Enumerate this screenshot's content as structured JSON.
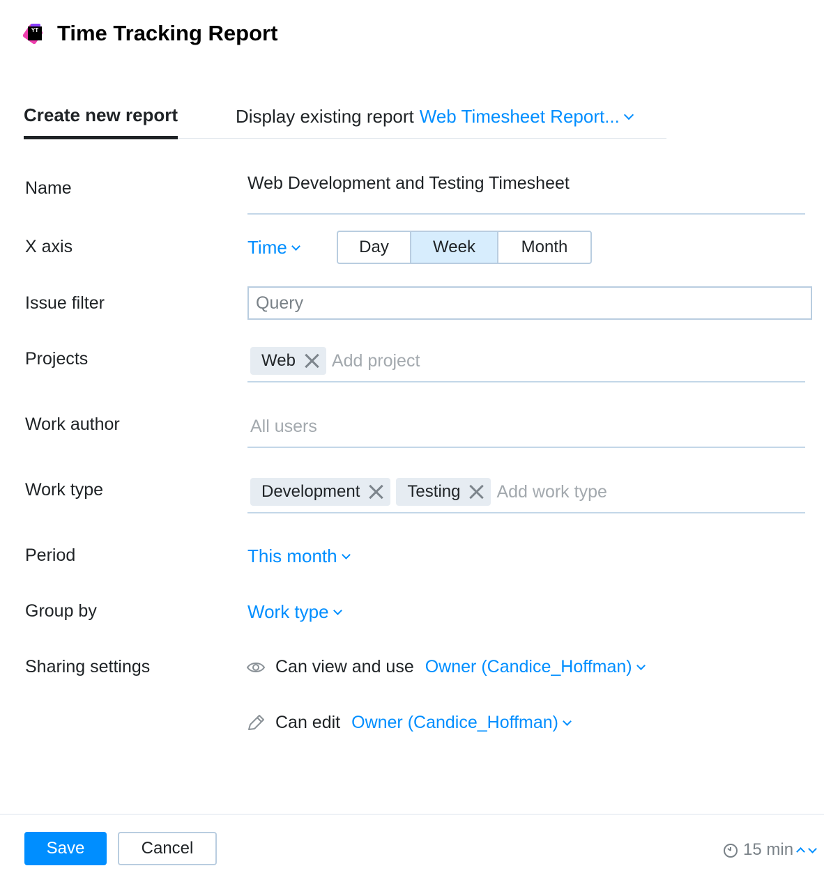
{
  "header": {
    "title": "Time Tracking Report",
    "logo_text": "YT"
  },
  "tabs": {
    "create": "Create new report",
    "display_prefix": "Display existing report",
    "display_link": "Web Timesheet Report..."
  },
  "form": {
    "name": {
      "label": "Name",
      "value": "Web Development and Testing Timesheet"
    },
    "x_axis": {
      "label": "X axis",
      "value": "Time",
      "options": [
        "Day",
        "Week",
        "Month"
      ],
      "selected": "Week"
    },
    "issue_filter": {
      "label": "Issue filter",
      "placeholder": "Query"
    },
    "projects": {
      "label": "Projects",
      "chips": [
        "Web"
      ],
      "placeholder": "Add project"
    },
    "work_author": {
      "label": "Work author",
      "placeholder": "All users"
    },
    "work_type": {
      "label": "Work type",
      "chips": [
        "Development",
        "Testing"
      ],
      "placeholder": "Add work type"
    },
    "period": {
      "label": "Period",
      "value": "This month"
    },
    "group_by": {
      "label": "Group by",
      "value": "Work type"
    },
    "sharing": {
      "label": "Sharing settings",
      "view_label": "Can view and use",
      "view_value": "Owner (Candice_Hoffman)",
      "edit_label": "Can edit",
      "edit_value": "Owner (Candice_Hoffman)"
    }
  },
  "footer": {
    "save": "Save",
    "cancel": "Cancel",
    "timer": "15 min"
  },
  "colors": {
    "accent": "#008eff",
    "selected_segment": "#d7edfd",
    "text": "#1f2326"
  }
}
